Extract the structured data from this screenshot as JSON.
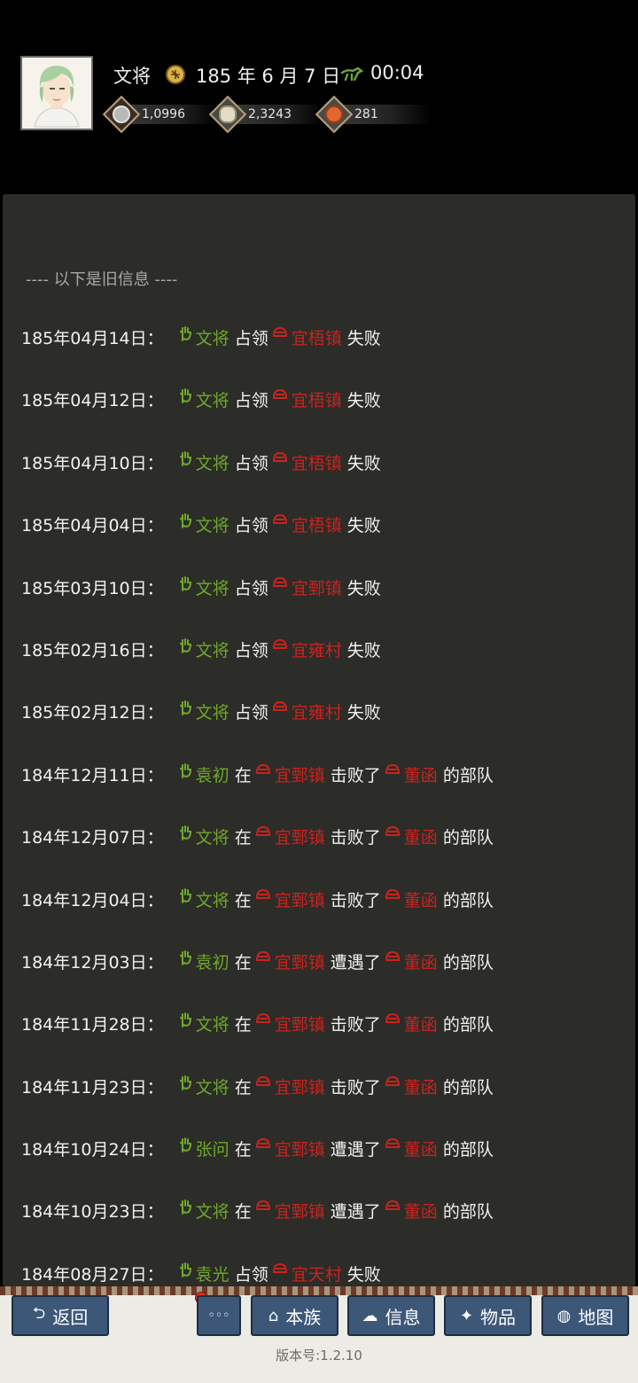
{
  "header": {
    "name": "文将",
    "date": "185 年 6 月 7 日",
    "time": "00:04",
    "resources": [
      {
        "icon": "coin-icon",
        "value": "1,0996"
      },
      {
        "icon": "grain-icon",
        "value": "2,3243"
      },
      {
        "icon": "food-icon",
        "value": "281"
      }
    ]
  },
  "panel": {
    "old_info_label": "---- 以下是旧信息 ----",
    "entries": [
      {
        "date": "185年04月14日：",
        "actor": "文将",
        "verb": "占领",
        "place": "宜梧镇",
        "result": "失败"
      },
      {
        "date": "185年04月12日：",
        "actor": "文将",
        "verb": "占领",
        "place": "宜梧镇",
        "result": "失败"
      },
      {
        "date": "185年04月10日：",
        "actor": "文将",
        "verb": "占领",
        "place": "宜梧镇",
        "result": "失败"
      },
      {
        "date": "185年04月04日：",
        "actor": "文将",
        "verb": "占领",
        "place": "宜梧镇",
        "result": "失败"
      },
      {
        "date": "185年03月10日：",
        "actor": "文将",
        "verb": "占领",
        "place": "宜鄄镇",
        "result": "失败"
      },
      {
        "date": "185年02月16日：",
        "actor": "文将",
        "verb": "占领",
        "place": "宜雍村",
        "result": "失败"
      },
      {
        "date": "185年02月12日：",
        "actor": "文将",
        "verb": "占领",
        "place": "宜雍村",
        "result": "失败"
      },
      {
        "date": "184年12月11日：",
        "actor": "袁初",
        "prep": "在",
        "place": "宜鄄镇",
        "verb": "击败了",
        "enemy": "董函",
        "tail": "的部队"
      },
      {
        "date": "184年12月07日：",
        "actor": "文将",
        "prep": "在",
        "place": "宜鄄镇",
        "verb": "击败了",
        "enemy": "董函",
        "tail": "的部队"
      },
      {
        "date": "184年12月04日：",
        "actor": "文将",
        "prep": "在",
        "place": "宜鄄镇",
        "verb": "击败了",
        "enemy": "董函",
        "tail": "的部队"
      },
      {
        "date": "184年12月03日：",
        "actor": "袁初",
        "prep": "在",
        "place": "宜鄄镇",
        "verb": "遭遇了",
        "enemy": "董函",
        "tail": "的部队"
      },
      {
        "date": "184年11月28日：",
        "actor": "文将",
        "prep": "在",
        "place": "宜鄄镇",
        "verb": "击败了",
        "enemy": "董函",
        "tail": "的部队"
      },
      {
        "date": "184年11月23日：",
        "actor": "文将",
        "prep": "在",
        "place": "宜鄄镇",
        "verb": "击败了",
        "enemy": "董函",
        "tail": "的部队"
      },
      {
        "date": "184年10月24日：",
        "actor": "张问",
        "prep": "在",
        "place": "宜鄄镇",
        "verb": "遭遇了",
        "enemy": "董函",
        "tail": "的部队"
      },
      {
        "date": "184年10月23日：",
        "actor": "文将",
        "prep": "在",
        "place": "宜鄄镇",
        "verb": "遭遇了",
        "enemy": "董函",
        "tail": "的部队"
      },
      {
        "date": "184年08月27日：",
        "actor": "袁光",
        "verb": "占领",
        "place": "宜天村",
        "result": "失败"
      }
    ]
  },
  "bottom_bar": {
    "back": "返回",
    "more": "◦◦◦",
    "clan": "本族",
    "info": "信息",
    "items": "物品",
    "map": "地图",
    "version": "版本号:1.2.10"
  }
}
